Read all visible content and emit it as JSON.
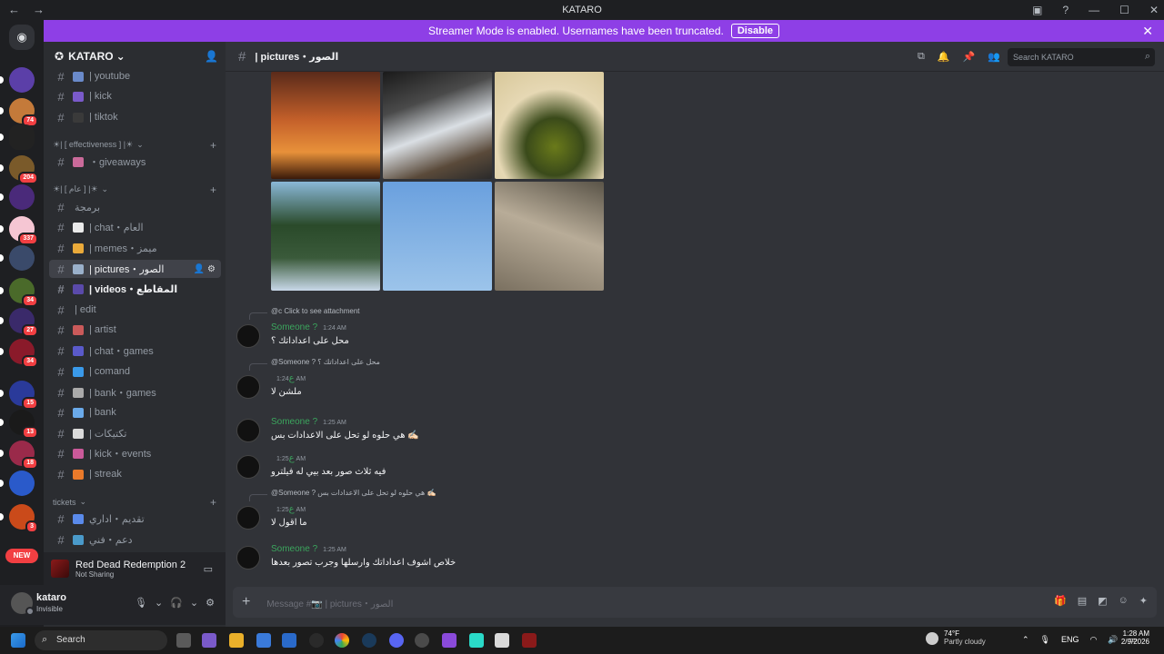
{
  "window": {
    "title": "KATARO",
    "back": "←",
    "forward": "→"
  },
  "banner": {
    "text": "Streamer Mode is enabled. Usernames have been truncated.",
    "button": "Disable",
    "close": "✕"
  },
  "servers": [
    {
      "color": "#5b3fa8",
      "badge": ""
    },
    {
      "color": "#c47a3a",
      "badge": "74"
    },
    {
      "color": "#222",
      "badge": ""
    },
    {
      "color": "#7a5a2a",
      "badge": "204"
    },
    {
      "color": "#4a2a7a",
      "badge": ""
    },
    {
      "color": "#f5c6d3",
      "badge": "337"
    },
    {
      "color": "#3a4a6a",
      "badge": ""
    },
    {
      "color": "#4a6a2a",
      "badge": "34"
    },
    {
      "color": "#3a2a6a",
      "badge": "27"
    },
    {
      "color": "#8a1a2a",
      "badge": "34"
    },
    {
      "color": "#2a3a9a",
      "badge": "15"
    },
    {
      "color": "#1a1a1a",
      "badge": "13"
    },
    {
      "color": "#9a2a4a",
      "badge": "18"
    },
    {
      "color": "#2a5aca",
      "badge": ""
    },
    {
      "color": "#ca4a1a",
      "badge": "3"
    }
  ],
  "new_badge": "NEW",
  "guild": {
    "name": "KATARO",
    "chevron": "⌄"
  },
  "channels": [
    {
      "name": "| youtube",
      "color": "#6a8aca"
    },
    {
      "name": "| kick",
      "color": "#7a5aca"
    },
    {
      "name": "| tiktok",
      "color": "#3a3a3a"
    },
    {
      "name": "・giveaways",
      "color": "#ca6a9a"
    },
    {
      "name": "برمجة",
      "color": ""
    },
    {
      "name": "| chat・العام",
      "color": "#eaeaea"
    },
    {
      "name": "| memes・ميمز",
      "color": "#eaaa3a"
    },
    {
      "name": "| pictures・الصور",
      "color": "#9ab0ca"
    },
    {
      "name": "| videos・المقاطع",
      "color": "#5a4aaa"
    },
    {
      "name": "| edit",
      "color": ""
    },
    {
      "name": "| artist",
      "color": "#ca5a5a"
    },
    {
      "name": "| chat・games",
      "color": "#5a5aca"
    },
    {
      "name": "| comand",
      "color": "#3a9aea"
    },
    {
      "name": "| bank・games",
      "color": "#aaaaaa"
    },
    {
      "name": "| bank",
      "color": "#6aaaea"
    },
    {
      "name": "| تكتيكات",
      "color": "#dadada"
    },
    {
      "name": "| kick・events",
      "color": "#ca5a9a"
    },
    {
      "name": "| streak",
      "color": "#ea7a2a"
    },
    {
      "name": "تقديم・اداري",
      "color": "#5a8aea"
    },
    {
      "name": "دعم・فني",
      "color": "#4a9aca"
    }
  ],
  "categories": [
    "☀| [ effectiveness ] |☀",
    "☀| [ عام ] |☀",
    "tickets"
  ],
  "activity": {
    "game": "Red Dead Redemption 2",
    "status": "Not Sharing"
  },
  "user": {
    "name": "kataro",
    "status": "Invisible"
  },
  "header": {
    "channel": "| pictures・الصور",
    "search_placeholder": "Search KATARO"
  },
  "messages": [
    {
      "reply": "@c  Click to see attachment",
      "user": "Someone ?",
      "time": "1:24 AM",
      "text": "محل على اعداداتك ؟"
    },
    {
      "reply": "@Someone ?  محل على اعداداتك ؟",
      "user": "ع",
      "time": "1:24 AM",
      "text": "ملشن لا"
    },
    {
      "reply": "",
      "user": "Someone ?",
      "time": "1:25 AM",
      "text": "هي حلوه لو تحل على الاعدادات بس ✍🏻"
    },
    {
      "reply": "",
      "user": "ع",
      "time": "1:25 AM",
      "text": "فيه ثلاث صور بعد بيي له فيلترو"
    },
    {
      "reply": "@Someone ?  هي حلوه لو تحل على الاعدادات بس ✍🏻",
      "user": "ع",
      "time": "1:25 AM",
      "text": "ما اقول لا"
    },
    {
      "reply": "",
      "user": "Someone ?",
      "time": "1:25 AM",
      "text": "خلاص اشوف اعداداتك وارسلها وجرب تصور بعدها"
    }
  ],
  "composer": {
    "placeholder": "Message #📷 | pictures・الصور"
  },
  "taskbar": {
    "search": "Search",
    "temp": "74°F",
    "weather": "Partly cloudy",
    "lang": "ENG",
    "time": "1:28 AM",
    "date": "2/9/2026"
  }
}
